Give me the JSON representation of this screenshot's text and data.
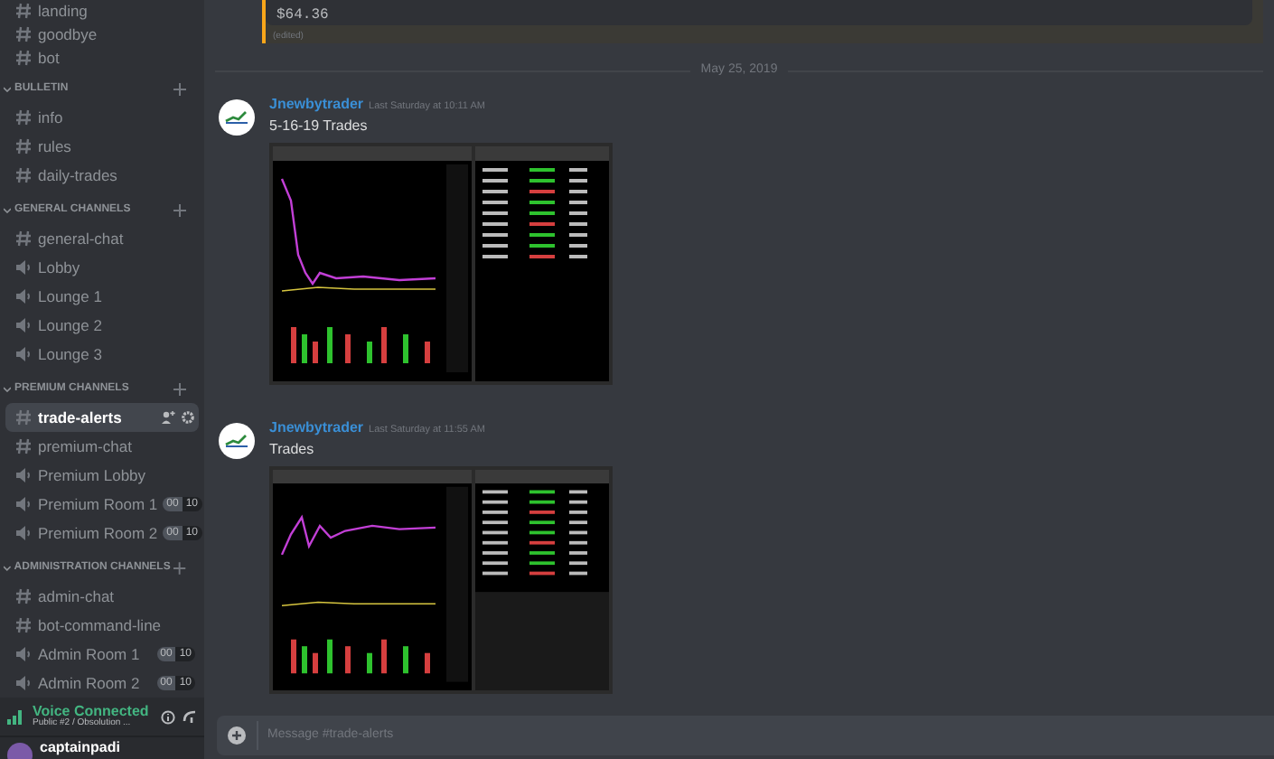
{
  "sidebar": {
    "top_channels": [
      {
        "name": "landing",
        "kind": "text",
        "selected": false
      },
      {
        "name": "goodbye",
        "kind": "text",
        "selected": false
      },
      {
        "name": "bot",
        "kind": "text",
        "selected": false
      }
    ],
    "categories": [
      {
        "title": "BULLETIN",
        "channels": [
          {
            "name": "info",
            "kind": "text",
            "selected": false
          },
          {
            "name": "rules",
            "kind": "text",
            "selected": false
          },
          {
            "name": "daily-trades",
            "kind": "text",
            "selected": false
          }
        ]
      },
      {
        "title": "GENERAL CHANNELS",
        "channels": [
          {
            "name": "general-chat",
            "kind": "text",
            "selected": false
          },
          {
            "name": "Lobby",
            "kind": "voice",
            "selected": false
          },
          {
            "name": "Lounge 1",
            "kind": "voice",
            "selected": false
          },
          {
            "name": "Lounge 2",
            "kind": "voice",
            "selected": false
          },
          {
            "name": "Lounge 3",
            "kind": "voice",
            "selected": false
          }
        ]
      },
      {
        "title": "PREMIUM CHANNELS",
        "channels": [
          {
            "name": "trade-alerts",
            "kind": "text",
            "selected": true
          },
          {
            "name": "premium-chat",
            "kind": "text",
            "selected": false
          },
          {
            "name": "Premium Lobby",
            "kind": "voice",
            "selected": false
          },
          {
            "name": "Premium Room 1",
            "kind": "voice",
            "selected": false,
            "users": "00",
            "limit": "10"
          },
          {
            "name": "Premium Room 2",
            "kind": "voice",
            "selected": false,
            "users": "00",
            "limit": "10"
          }
        ]
      },
      {
        "title": "ADMINISTRATION CHANNELS",
        "channels": [
          {
            "name": "admin-chat",
            "kind": "text",
            "selected": false
          },
          {
            "name": "bot-command-line",
            "kind": "text",
            "selected": false
          },
          {
            "name": "Admin Room 1",
            "kind": "voice",
            "selected": false,
            "users": "00",
            "limit": "10"
          },
          {
            "name": "Admin Room 2",
            "kind": "voice",
            "selected": false,
            "users": "00",
            "limit": "10"
          }
        ]
      }
    ],
    "voice": {
      "status": "Voice Connected",
      "channel": "Public #2 / Obsolution ..."
    },
    "user": {
      "name": "captainpadi"
    }
  },
  "chat": {
    "previous": {
      "amount": "$64.36",
      "edited": "(edited)"
    },
    "date_divider": "May 25, 2019",
    "messages": [
      {
        "author": "Jnewbytrader",
        "time": "Last Saturday at 10:11 AM",
        "text": "5-16-19 Trades"
      },
      {
        "author": "Jnewbytrader",
        "time": "Last Saturday at 11:55 AM",
        "text": "Trades"
      }
    ],
    "input": {
      "placeholder": "Message #trade-alerts"
    }
  }
}
